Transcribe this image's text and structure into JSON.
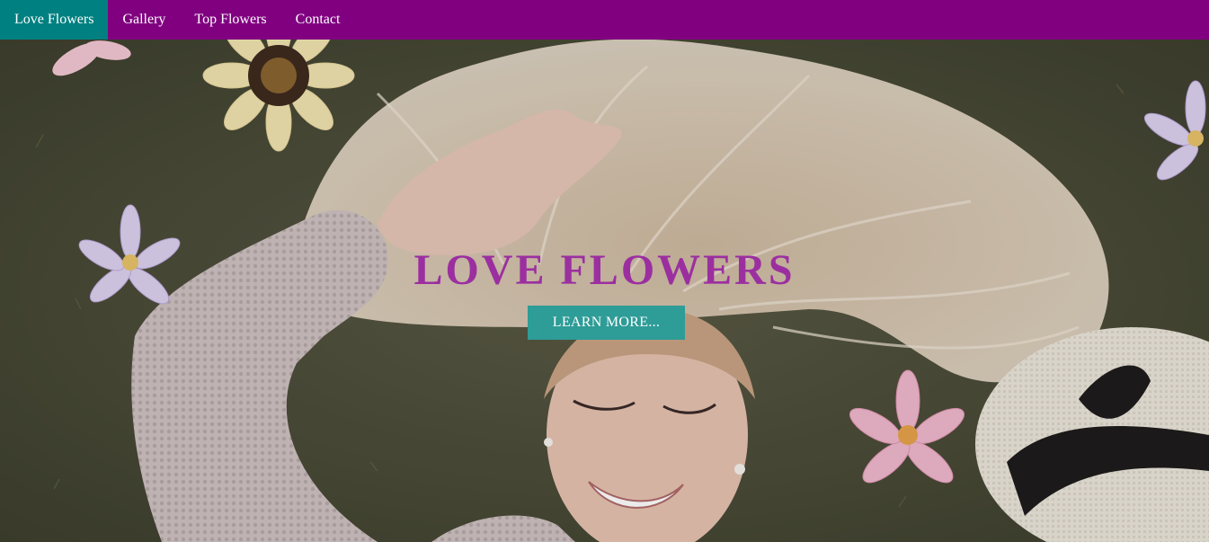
{
  "nav": {
    "items": [
      {
        "label": "Love Flowers",
        "active": true
      },
      {
        "label": "Gallery",
        "active": false
      },
      {
        "label": "Top Flowers",
        "active": false
      },
      {
        "label": "Contact",
        "active": false
      }
    ]
  },
  "hero": {
    "title": "LOVE FLOWERS",
    "button_label": "LEARN MORE..."
  },
  "colors": {
    "nav_background": "#800080",
    "nav_active": "#008080",
    "title": "#9b2fa0",
    "button": "#2e9c97"
  }
}
